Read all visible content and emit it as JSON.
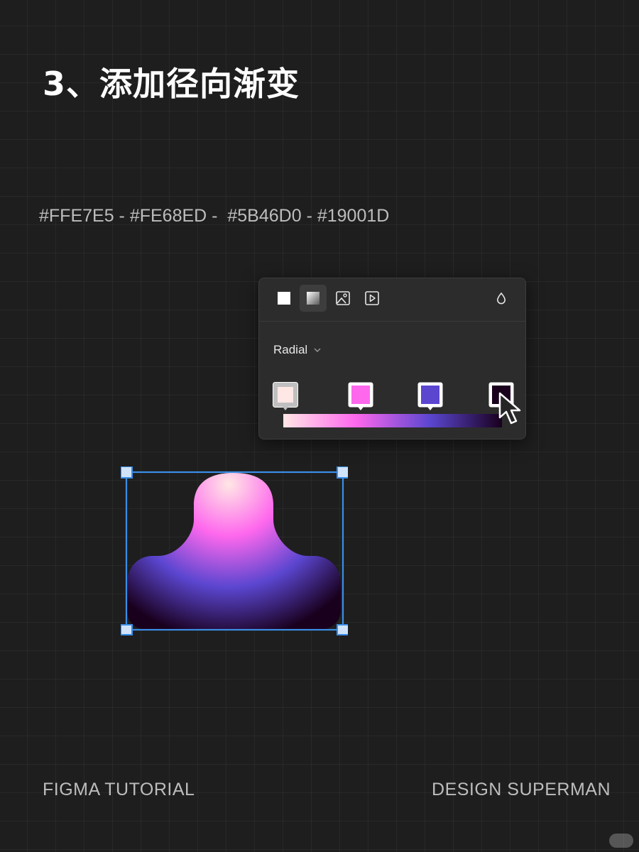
{
  "slide": {
    "title": "3、添加径向渐变",
    "color_line": "#FFE7E5 - #FE68ED -  #5B46D0 - #19001D"
  },
  "fill_panel": {
    "tool_icons": [
      "solid-fill-icon",
      "gradient-fill-icon",
      "image-fill-icon",
      "video-fill-icon"
    ],
    "active_tool": "gradient-fill-icon",
    "opacity_icon": "drop-icon",
    "gradient_type": "Radial",
    "stops": [
      {
        "color": "#FFE7E5"
      },
      {
        "color": "#FE68ED"
      },
      {
        "color": "#5B46D0"
      },
      {
        "color": "#19001D"
      }
    ]
  },
  "footer": {
    "left": "FIGMA TUTORIAL",
    "right": "DESIGN SUPERMAN"
  },
  "colors": {
    "selection": "#3a8ee6",
    "canvas_bg": "#1e1e1e",
    "panel_bg": "#2c2c2c"
  },
  "watermark": "小红书"
}
